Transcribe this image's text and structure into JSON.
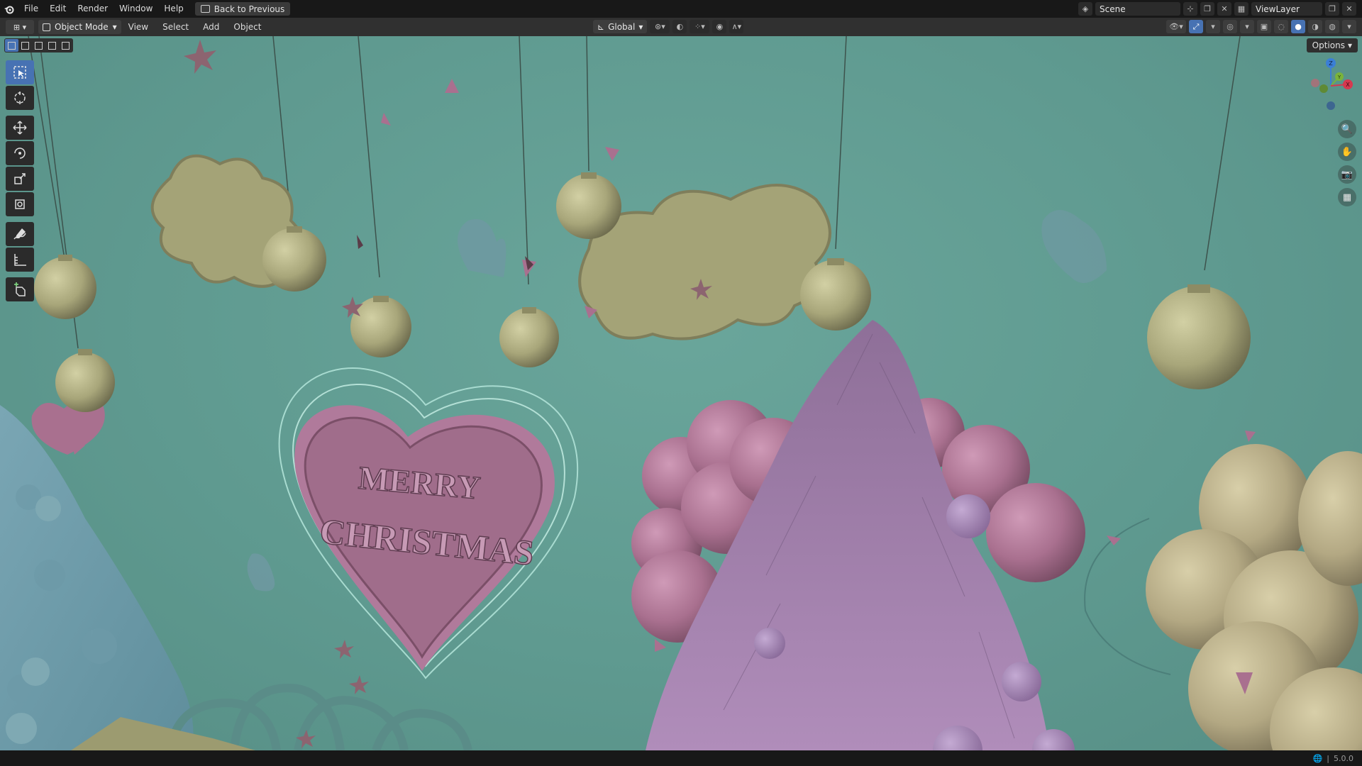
{
  "topbar": {
    "menus": [
      "File",
      "Edit",
      "Render",
      "Window",
      "Help"
    ],
    "back_button": "Back to Previous",
    "scene_name": "Scene",
    "view_layer": "ViewLayer"
  },
  "viewport_header": {
    "mode": "Object Mode",
    "menus": [
      "View",
      "Select",
      "Add",
      "Object"
    ],
    "transform_orientation": "Global"
  },
  "viewport": {
    "options_label": "Options",
    "greeting_line1": "MERRY",
    "greeting_line2": "CHRISTMAS",
    "gizmo": {
      "z": "Z",
      "y": "Y",
      "x": "X"
    }
  },
  "icons": {
    "blender": "blender-logo-icon",
    "back": "back-to-previous-icon",
    "scene": "scene-icon",
    "view_layer": "view-layer-icon",
    "tools": [
      "select-box-icon",
      "cursor-icon",
      "move-icon",
      "rotate-icon",
      "scale-icon",
      "transform-icon",
      "annotate-icon",
      "measure-icon",
      "add-cube-icon"
    ],
    "nav": [
      "zoom-icon",
      "hand-pan-icon",
      "camera-icon",
      "grid-icon"
    ]
  },
  "colors": {
    "viewport_bg": "#5f9a90",
    "active_blue": "#4772b3",
    "pink": "#a9708f",
    "olive": "#a8a67a",
    "purple_tree": "#a380b0",
    "blue_tree": "#7aa6b4"
  },
  "statusbar": {
    "version": "5.0.0"
  }
}
